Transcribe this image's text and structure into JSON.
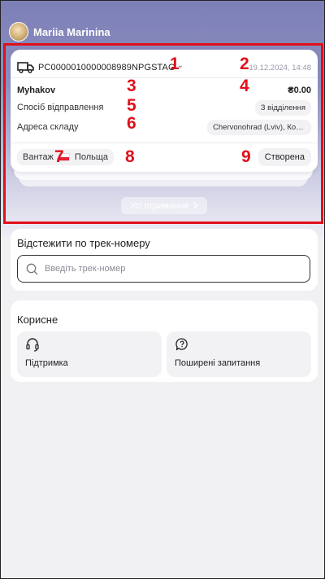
{
  "user": {
    "name": "Mariia Marinina"
  },
  "shipment": {
    "tracking_number": "PC0000010000008989NPGSTAG",
    "date": "19.12.2024, 14:48",
    "recipient": "Myhakov",
    "amount": "₴0.00",
    "delivery_method_label": "Спосіб відправлення",
    "delivery_method_value": "З відділення",
    "warehouse_label": "Адреса складу",
    "warehouse_value": "Chervonohrad (Lviv), Коре…",
    "cargo_label": "Вантаж",
    "country": "Польща",
    "status": "Створена"
  },
  "markers": [
    "1",
    "2",
    "3",
    "4",
    "5",
    "6",
    "7",
    "8",
    "9"
  ],
  "all_receipts_label": "Усі отримання",
  "tracking_section": {
    "title": "Відстежити по трек-номеру",
    "placeholder": "Введіть трек-номер"
  },
  "useful_section": {
    "title": "Корисне",
    "support_label": "Підтримка",
    "faq_label": "Поширені запитання"
  },
  "colors": {
    "accent": "#e0101a",
    "header_gradient_top": "#7c7fb6",
    "background": "#f1f1f4"
  }
}
